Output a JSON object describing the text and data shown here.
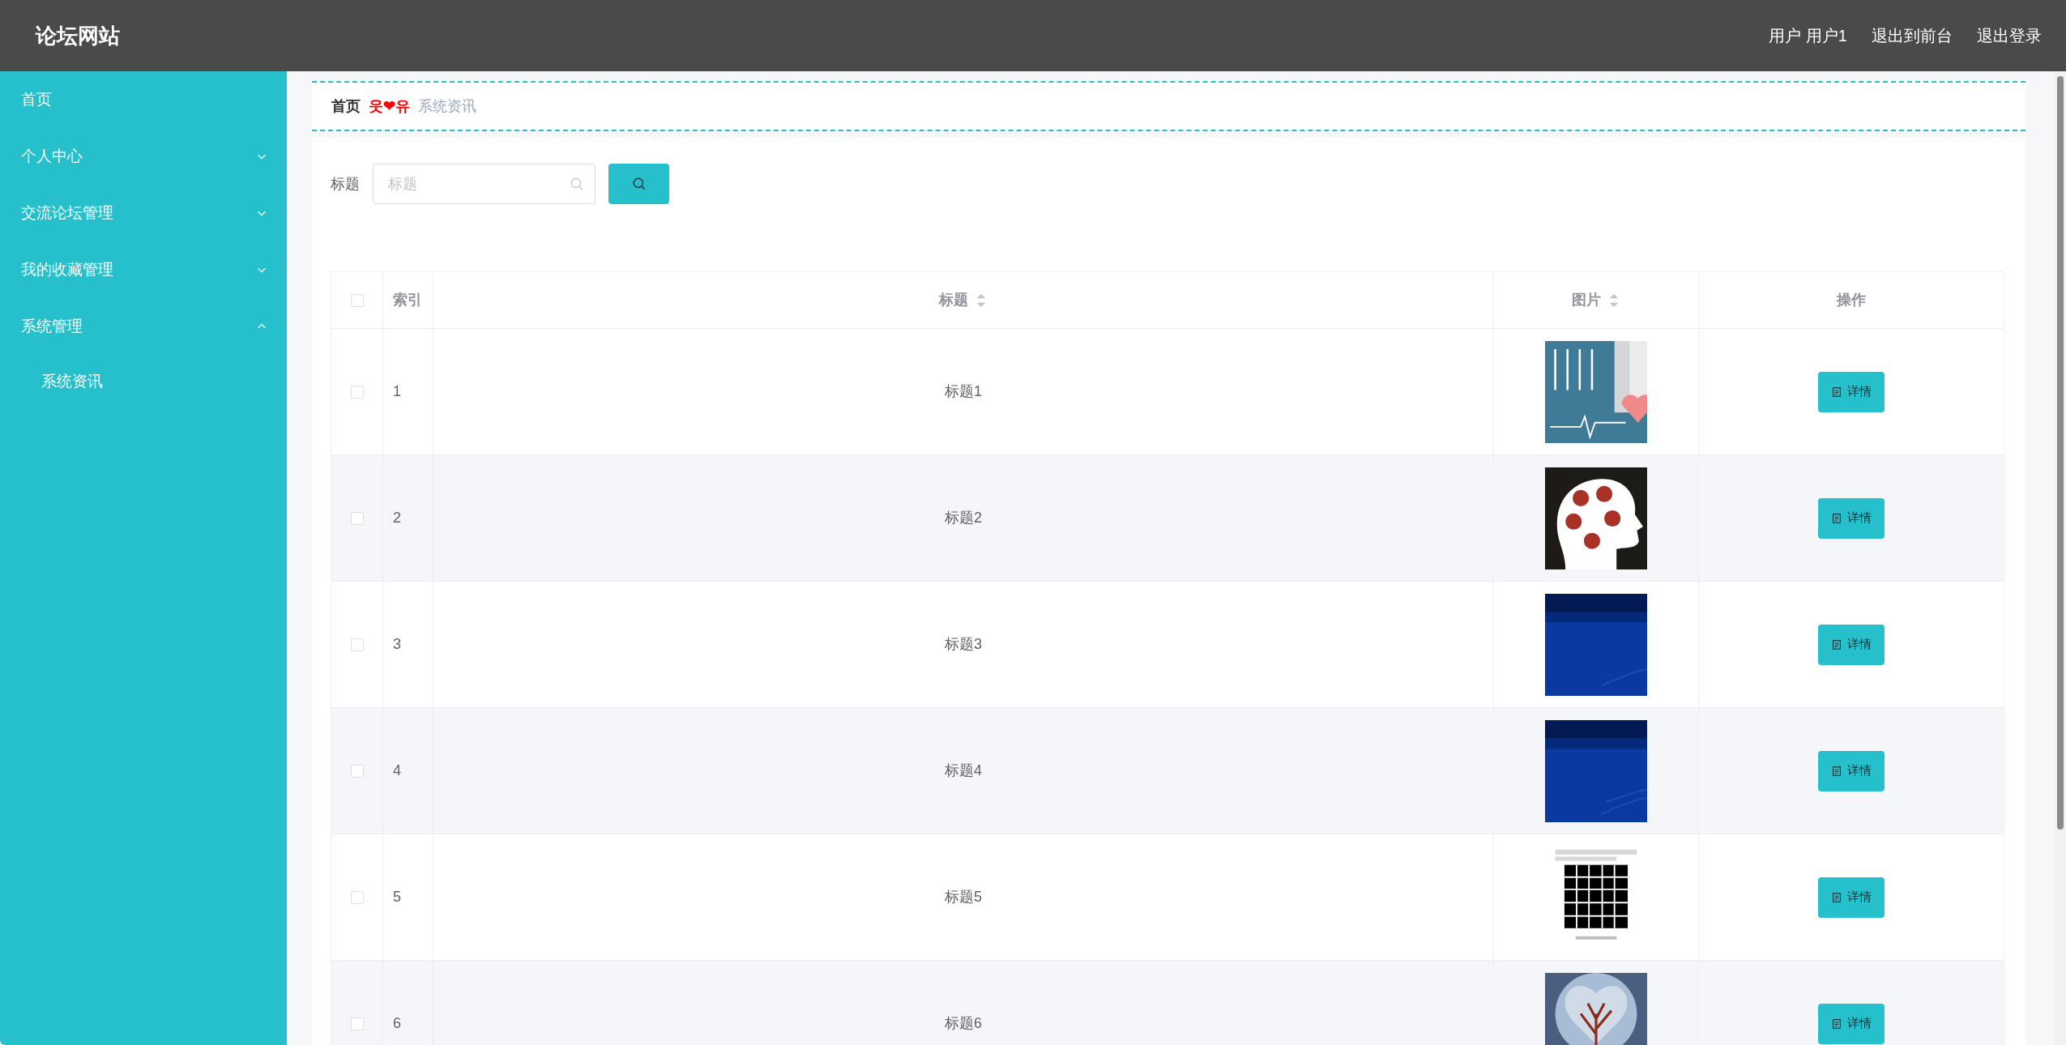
{
  "header": {
    "title": "论坛网站",
    "links": [
      {
        "label": "用户 用户1"
      },
      {
        "label": "退出到前台"
      },
      {
        "label": "退出登录"
      }
    ]
  },
  "sidebar": {
    "items": [
      {
        "label": "首页",
        "kind": "link"
      },
      {
        "label": "个人中心",
        "kind": "menu",
        "expanded": false
      },
      {
        "label": "交流论坛管理",
        "kind": "menu",
        "expanded": false
      },
      {
        "label": "我的收藏管理",
        "kind": "menu",
        "expanded": false
      },
      {
        "label": "系统管理",
        "kind": "menu",
        "expanded": true,
        "children": [
          {
            "label": "系统资讯"
          }
        ]
      }
    ]
  },
  "breadcrumb": {
    "home": "首页",
    "separator": "웃❤유",
    "current": "系统资讯"
  },
  "search": {
    "label": "标题",
    "placeholder": "标题"
  },
  "table": {
    "select_all": {
      "checked": false
    },
    "columns": [
      {
        "label": "索引",
        "sortable": false
      },
      {
        "label": "标题",
        "sortable": true
      },
      {
        "label": "图片",
        "sortable": true
      },
      {
        "label": "操作",
        "sortable": false
      }
    ],
    "rows": [
      {
        "checked": false,
        "index": "1",
        "title": "标题1",
        "action": "详情"
      },
      {
        "checked": false,
        "index": "2",
        "title": "标题2",
        "action": "详情"
      },
      {
        "checked": false,
        "index": "3",
        "title": "标题3",
        "action": "详情"
      },
      {
        "checked": false,
        "index": "4",
        "title": "标题4",
        "action": "详情"
      },
      {
        "checked": false,
        "index": "5",
        "title": "标题5",
        "action": "详情"
      },
      {
        "checked": false,
        "index": "6",
        "title": "标题6",
        "action": "详情"
      }
    ]
  }
}
